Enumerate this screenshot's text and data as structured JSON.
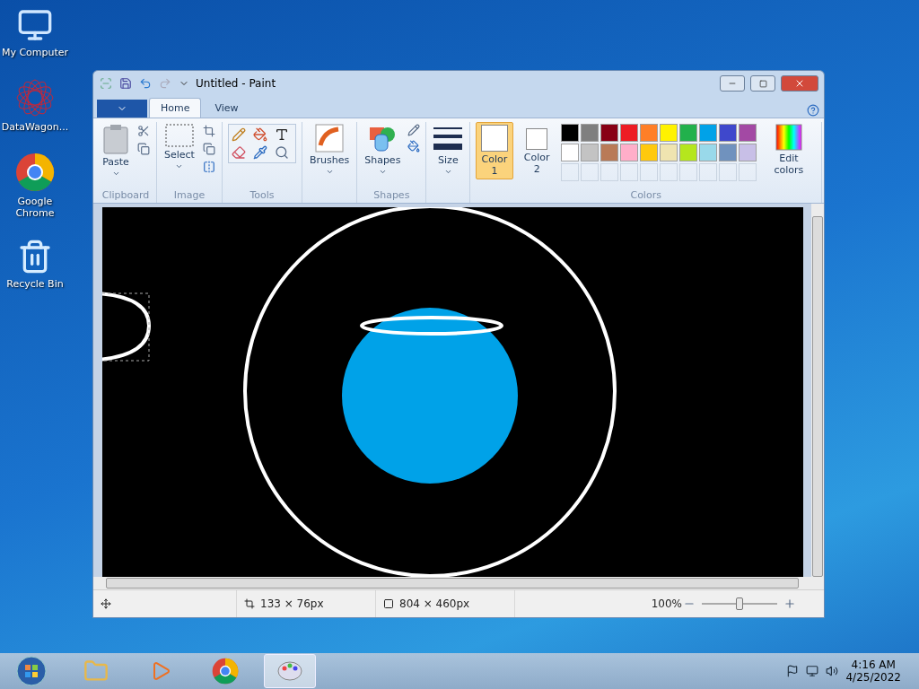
{
  "desktop_icons": [
    {
      "kind": "computer",
      "label": "My Computer"
    },
    {
      "kind": "datawagon",
      "label": "DataWagon..."
    },
    {
      "kind": "chrome",
      "label": "Google Chrome"
    },
    {
      "kind": "recycle",
      "label": "Recycle Bin"
    }
  ],
  "window": {
    "title": "Untitled - Paint"
  },
  "ribbon_tabs": [
    {
      "label": "Home",
      "selected": true
    },
    {
      "label": "View",
      "selected": false
    }
  ],
  "clipboard": {
    "label": "Clipboard",
    "paste": "Paste"
  },
  "image": {
    "label": "Image",
    "select": "Select"
  },
  "tools": {
    "label": "Tools"
  },
  "brushes": {
    "label": "Brushes"
  },
  "shapes": {
    "label": "Shapes",
    "button": "Shapes"
  },
  "size": {
    "label": "Size"
  },
  "colors": {
    "label": "Colors",
    "edit": "Edit colors",
    "slots": [
      {
        "label": "Color 1",
        "selected": true,
        "color": "#ffffff"
      },
      {
        "label": "Color 2",
        "selected": false,
        "color": "#ffffff"
      }
    ],
    "palette": [
      {
        "color": "#000000"
      },
      {
        "color": "#7f7f7f"
      },
      {
        "color": "#880015"
      },
      {
        "color": "#ed1c24"
      },
      {
        "color": "#ff7f27"
      },
      {
        "color": "#fff200"
      },
      {
        "color": "#22b14c"
      },
      {
        "color": "#00a2e8"
      },
      {
        "color": "#3f48cc"
      },
      {
        "color": "#a349a4"
      },
      {
        "color": "#ffffff"
      },
      {
        "color": "#c3c3c3"
      },
      {
        "color": "#b97a57"
      },
      {
        "color": "#ffaec9"
      },
      {
        "color": "#ffc90e"
      },
      {
        "color": "#efe4b0"
      },
      {
        "color": "#b5e61d"
      },
      {
        "color": "#99d9ea"
      },
      {
        "color": "#7092be"
      },
      {
        "color": "#c8bfe7"
      }
    ]
  },
  "status_bar": {
    "selection_size": "133 × 76px",
    "canvas_size": "804 × 460px",
    "zoom": "100%",
    "zoom_slider": {
      "level": 0.5
    }
  },
  "taskbar": {
    "time": "4:16 AM",
    "date": "4/25/2022"
  }
}
